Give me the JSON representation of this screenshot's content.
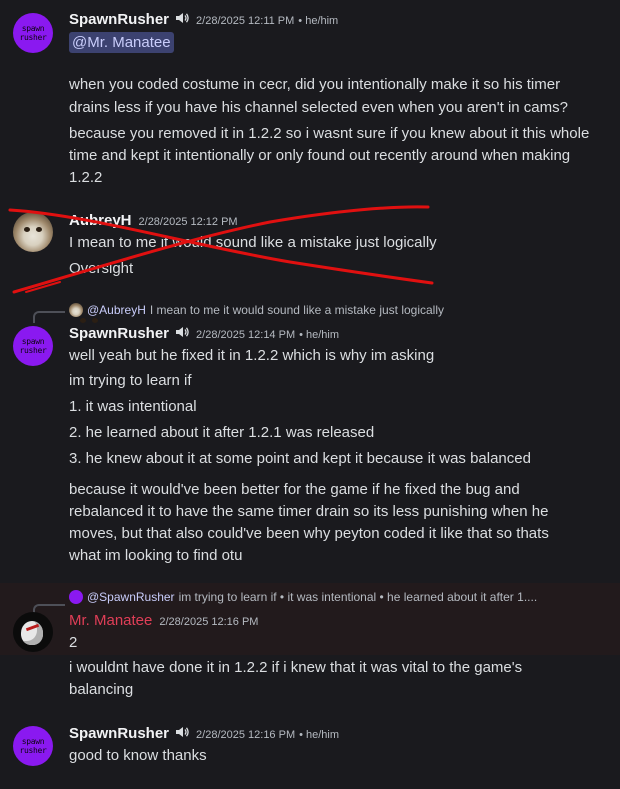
{
  "messages": [
    {
      "author": "SpawnRusher",
      "avatar_text": [
        "spawn",
        "rusher"
      ],
      "timestamp": "2/28/2025 12:11 PM",
      "pronouns": "• he/him",
      "mention": "@Mr. Manatee",
      "lines": [
        "when you coded costume in cecr, did you intentionally make it so his timer",
        "drains less if you have his channel selected even when you aren't in cams?",
        "because you removed it in 1.2.2 so i wasnt sure if you knew about it this whole",
        "time and kept it intentionally or only found out recently around when making",
        "1.2.2"
      ]
    },
    {
      "author": "AubreyH",
      "timestamp": "2/28/2025 12:12 PM",
      "lines": [
        "I mean to me it would sound like a mistake just logically",
        "Oversight"
      ]
    },
    {
      "reply_user": "@AubreyH",
      "reply_text": "I mean to me it would sound like a mistake just logically",
      "author": "SpawnRusher",
      "avatar_text": [
        "spawn",
        "rusher"
      ],
      "timestamp": "2/28/2025 12:14 PM",
      "pronouns": "• he/him",
      "lines": [
        "well yeah but he fixed it in 1.2.2 which is why im asking",
        "im trying to learn if",
        "1. it was intentional",
        "2. he learned about it after 1.2.1 was released",
        "3. he knew about it at some point and kept it because it was balanced",
        "because it would've been better for the game if he fixed the bug and",
        "rebalanced it to have the same timer drain so its less punishing when he",
        "moves, but that also could've been why peyton coded it like that so thats",
        "what im looking to find otu"
      ]
    },
    {
      "reply_user": "@SpawnRusher",
      "reply_text": "im trying to learn if • it was intentional  • he learned about it after 1....",
      "author": "Mr. Manatee",
      "timestamp": "2/28/2025 12:16 PM",
      "lines": [
        "2",
        "i wouldnt have done it in 1.2.2 if i knew that it was vital to the game's",
        "balancing"
      ]
    },
    {
      "author": "SpawnRusher",
      "avatar_text": [
        "spawn",
        "rusher"
      ],
      "timestamp": "2/28/2025 12:16 PM",
      "pronouns": "• he/him",
      "lines": [
        "good to know thanks"
      ]
    }
  ],
  "colors": {
    "background": "#1a1a1e",
    "username": "#f2f3f5",
    "manatee_role": "#e03e57",
    "mention_bg": "#3c4270",
    "spawn_avatar": "#8a19f0",
    "scribble": "#e01010"
  },
  "icons": [
    "speaker-icon",
    "reply-avatar-icon"
  ]
}
